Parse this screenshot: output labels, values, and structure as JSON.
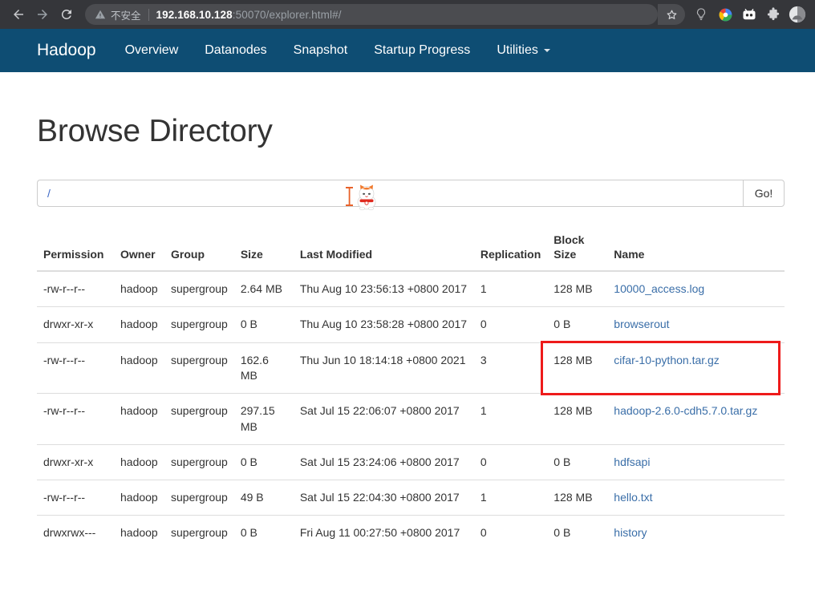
{
  "browser": {
    "back_icon": "back-arrow-icon",
    "forward_icon": "forward-arrow-icon",
    "reload_icon": "reload-icon",
    "security_label": "不安全",
    "url_host": "192.168.10.128",
    "url_rest": ":50070/explorer.html#/",
    "toolbar_icons": [
      {
        "name": "bookmark-star-icon",
        "glyph": "☆"
      },
      {
        "name": "lightbulb-icon",
        "glyph": ""
      },
      {
        "name": "google-circle-icon",
        "glyph": ""
      },
      {
        "name": "bilibili-icon",
        "glyph": ""
      },
      {
        "name": "extensions-puzzle-icon",
        "glyph": ""
      },
      {
        "name": "profile-avatar-icon",
        "glyph": ""
      }
    ]
  },
  "navbar": {
    "brand": "Hadoop",
    "links": [
      {
        "label": "Overview",
        "caret": false
      },
      {
        "label": "Datanodes",
        "caret": false
      },
      {
        "label": "Snapshot",
        "caret": false
      },
      {
        "label": "Startup Progress",
        "caret": false
      },
      {
        "label": "Utilities",
        "caret": true
      }
    ]
  },
  "page": {
    "title": "Browse Directory",
    "path_value": "/",
    "path_placeholder": "",
    "go_label": "Go!",
    "cursor_icon": "cat-text-cursor-icon"
  },
  "table": {
    "headers": [
      "Permission",
      "Owner",
      "Group",
      "Size",
      "Last Modified",
      "Replication",
      "Block\nSize",
      "Name"
    ],
    "header_block_size_line1": "Block",
    "header_block_size_line2": "Size",
    "rows": [
      {
        "permission": "-rw-r--r--",
        "owner": "hadoop",
        "group": "supergroup",
        "size": "2.64 MB",
        "modified": "Thu Aug 10 23:56:13 +0800 2017",
        "replication": "1",
        "block_size": "128 MB",
        "name": "10000_access.log"
      },
      {
        "permission": "drwxr-xr-x",
        "owner": "hadoop",
        "group": "supergroup",
        "size": "0 B",
        "modified": "Thu Aug 10 23:58:28 +0800 2017",
        "replication": "0",
        "block_size": "0 B",
        "name": "browserout"
      },
      {
        "permission": "-rw-r--r--",
        "owner": "hadoop",
        "group": "supergroup",
        "size": "162.6 MB",
        "modified": "Thu Jun 10 18:14:18 +0800 2021",
        "replication": "3",
        "block_size": "128 MB",
        "name": "cifar-10-python.tar.gz"
      },
      {
        "permission": "-rw-r--r--",
        "owner": "hadoop",
        "group": "supergroup",
        "size": "297.15 MB",
        "modified": "Sat Jul 15 22:06:07 +0800 2017",
        "replication": "1",
        "block_size": "128 MB",
        "name": "hadoop-2.6.0-cdh5.7.0.tar.gz"
      },
      {
        "permission": "drwxr-xr-x",
        "owner": "hadoop",
        "group": "supergroup",
        "size": "0 B",
        "modified": "Sat Jul 15 23:24:06 +0800 2017",
        "replication": "0",
        "block_size": "0 B",
        "name": "hdfsapi"
      },
      {
        "permission": "-rw-r--r--",
        "owner": "hadoop",
        "group": "supergroup",
        "size": "49 B",
        "modified": "Sat Jul 15 22:04:30 +0800 2017",
        "replication": "1",
        "block_size": "128 MB",
        "name": "hello.txt"
      },
      {
        "permission": "drwxrwx---",
        "owner": "hadoop",
        "group": "supergroup",
        "size": "0 B",
        "modified": "Fri Aug 11 00:27:50 +0800 2017",
        "replication": "0",
        "block_size": "0 B",
        "name": "history"
      }
    ]
  },
  "annotation": {
    "highlight_color": "#ee1b1b",
    "highlight_target": "cifar-10-python.tar.gz"
  },
  "colors": {
    "navbar_bg": "#0e4d73",
    "link": "#3a6ea8",
    "chrome_bg": "#35363a"
  }
}
